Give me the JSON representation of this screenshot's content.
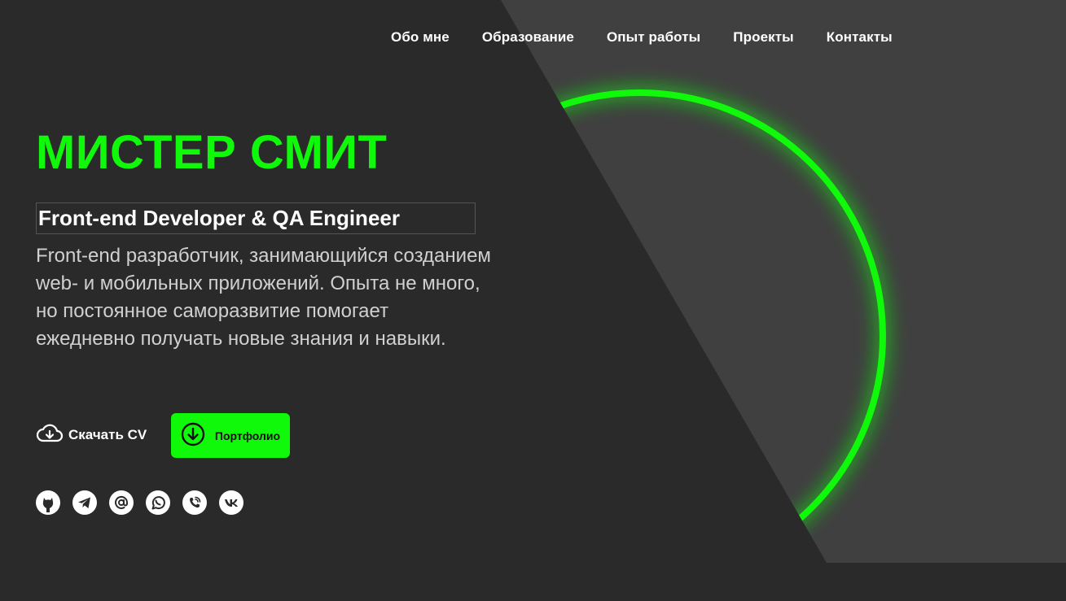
{
  "nav": {
    "items": [
      {
        "label": "Обо мне"
      },
      {
        "label": "Образование"
      },
      {
        "label": "Опыт работы"
      },
      {
        "label": "Проекты"
      },
      {
        "label": "Контакты"
      }
    ]
  },
  "hero": {
    "name": "МИСТЕР СМИТ",
    "role": "Front-end Developer & QA Engineer",
    "description": "Front-end разработчик, занимающийся созданием web- и мобильных приложений. Опыта не много, но постоянное саморазвитие помогает ежедневно получать новые знания и навыки."
  },
  "actions": {
    "download_cv": "Скачать CV",
    "portfolio": "Портфолио"
  },
  "socials": [
    {
      "icon": "github-icon"
    },
    {
      "icon": "telegram-icon"
    },
    {
      "icon": "email-icon"
    },
    {
      "icon": "whatsapp-icon"
    },
    {
      "icon": "viber-icon"
    },
    {
      "icon": "vk-icon"
    }
  ],
  "colors": {
    "accent": "#10f80a",
    "background": "#2a2a2a",
    "panel": "#404040"
  }
}
